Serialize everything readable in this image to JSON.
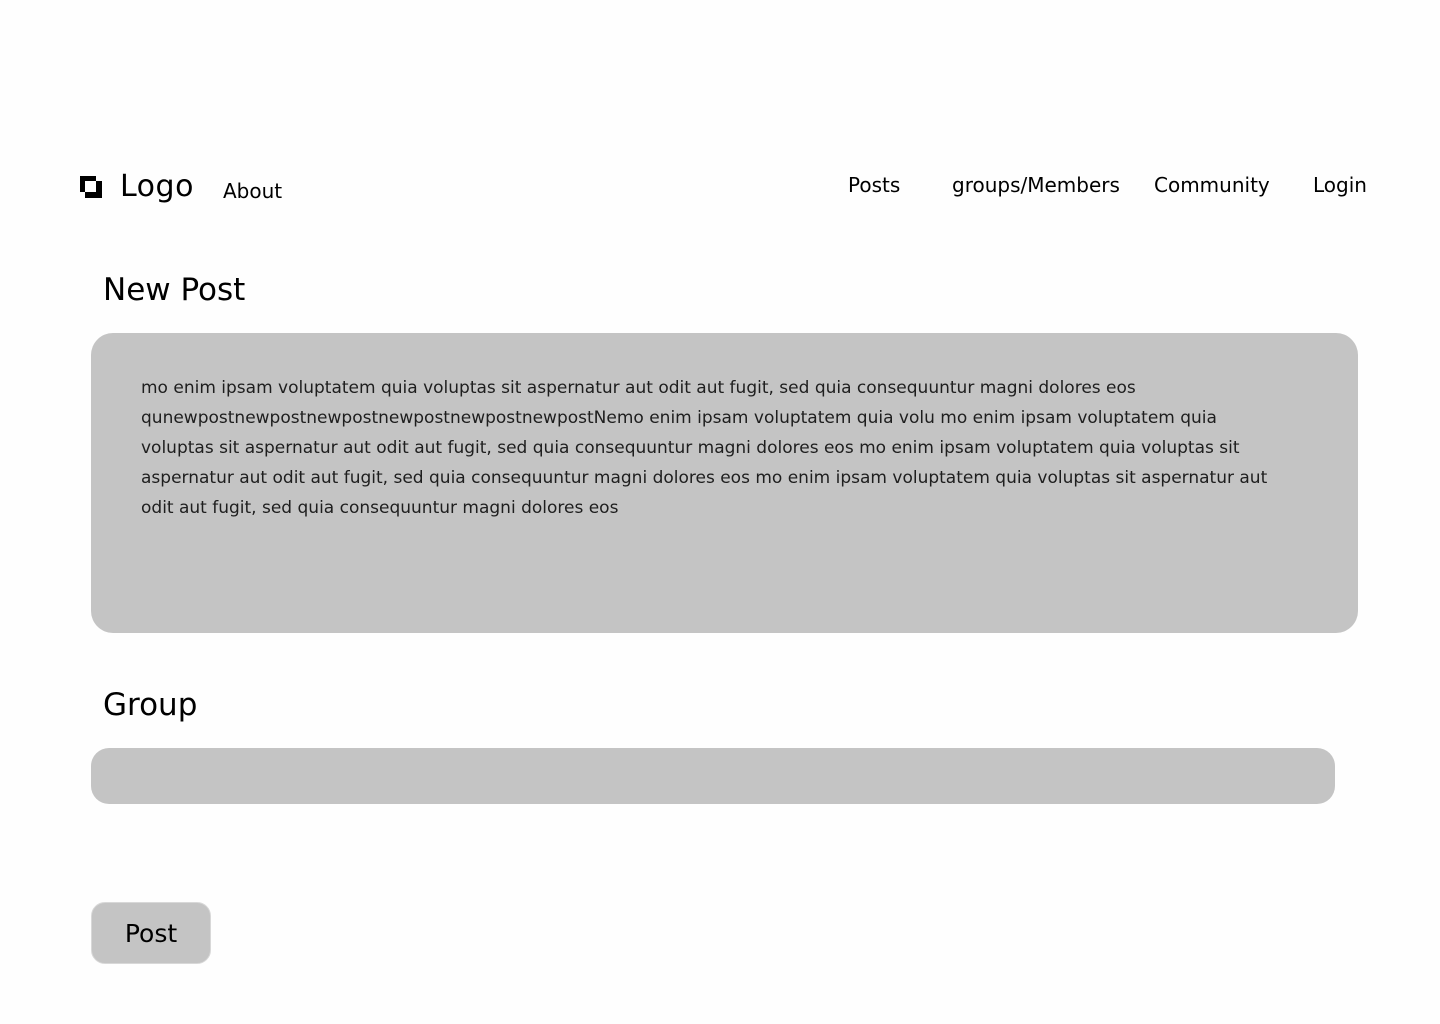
{
  "header": {
    "logo_text": "Logo",
    "logo_icon": "logo-squares-icon",
    "nav_left": {
      "about": "About"
    },
    "nav_right": {
      "posts": "Posts",
      "groups_members": "groups/Members",
      "community": "Community",
      "login": "Login"
    }
  },
  "new_post": {
    "title": "New Post",
    "body_text": "mo enim ipsam voluptatem quia voluptas sit aspernatur aut odit aut fugit, sed quia consequuntur magni dolores eos qunewpostnewpostnewpostnewpostnewpostnewpostNemo enim ipsam voluptatem quia volu mo enim ipsam voluptatem quia voluptas sit aspernatur aut odit aut fugit, sed quia consequuntur magni dolores eos mo enim ipsam voluptatem quia voluptas sit aspernatur aut odit aut fugit, sed quia consequuntur magni dolores eos  mo enim ipsam voluptatem quia voluptas sit aspernatur aut odit aut fugit, sed quia consequuntur magni dolores eos"
  },
  "group": {
    "title": "Group",
    "input_value": "",
    "input_placeholder": ""
  },
  "actions": {
    "post_label": "Post"
  },
  "colors": {
    "background": "#fefefe",
    "field_fill": "#c4c4c4",
    "text": "#000000",
    "body_text": "#1e1e1e"
  }
}
